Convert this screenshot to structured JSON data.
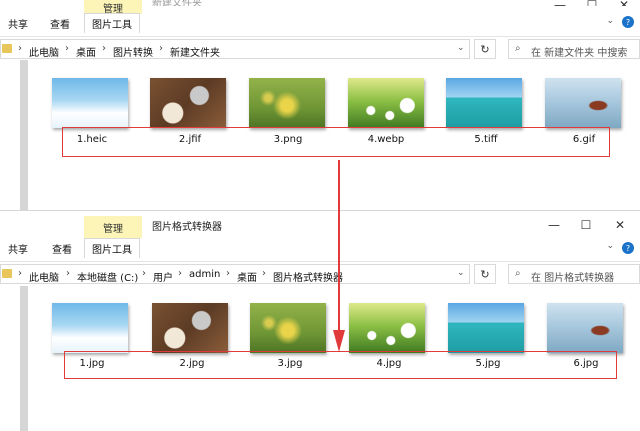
{
  "top": {
    "window_title": "新建文件夹",
    "ribbon": {
      "manage": "管理",
      "share": "共享",
      "view": "查看",
      "picture_tools": "图片工具"
    },
    "breadcrumb": [
      "此电脑",
      "桌面",
      "图片转换",
      "新建文件夹"
    ],
    "search_placeholder": "在 新建文件夹 中搜索",
    "files": [
      "1.heic",
      "2.jfif",
      "3.png",
      "4.webp",
      "5.tiff",
      "6.gif"
    ]
  },
  "bottom": {
    "window_title": "图片格式转换器",
    "ribbon": {
      "manage": "管理",
      "share": "共享",
      "view": "查看",
      "picture_tools": "图片工具"
    },
    "breadcrumb": [
      "此电脑",
      "本地磁盘 (C:)",
      "用户",
      "admin",
      "桌面",
      "图片格式转换器"
    ],
    "search_placeholder": "在 图片格式转换器",
    "files": [
      "1.jpg",
      "2.jpg",
      "3.jpg",
      "4.jpg",
      "5.jpg",
      "6.jpg"
    ]
  },
  "colors": {
    "highlight_box": "#e03a3a",
    "manage_tab": "#fcf5b7",
    "arrow": "#e03a3a"
  },
  "icons": [
    "folder-icon",
    "chevron-down-icon",
    "refresh-icon",
    "search-icon",
    "minimize-icon",
    "maximize-icon",
    "close-icon",
    "help-icon",
    "red-arrow-icon"
  ]
}
